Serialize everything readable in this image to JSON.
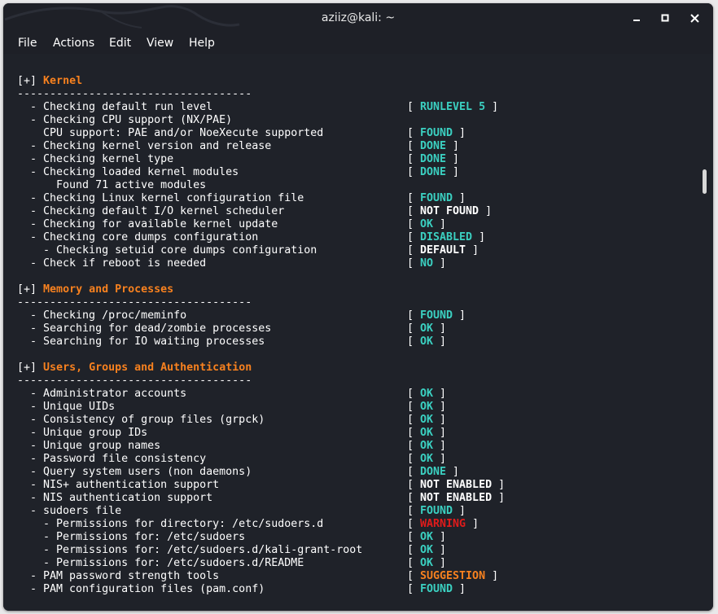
{
  "window": {
    "title": "aziiz@kali: ~"
  },
  "menu": [
    "File",
    "Actions",
    "Edit",
    "View",
    "Help"
  ],
  "colors": {
    "ok": "#3bd0c1",
    "white": "#ffffff",
    "warning": "#e01b1b",
    "orange": "#f7811f"
  },
  "terminal": {
    "lines": [
      {
        "type": "head",
        "bracket": "[+]",
        "title": "Kernel"
      },
      {
        "type": "text",
        "text": "------------------------------------"
      },
      {
        "type": "check",
        "text": "  - Checking default run level",
        "status": "RUNLEVEL 5",
        "color": "ok"
      },
      {
        "type": "text",
        "text": "  - Checking CPU support (NX/PAE)"
      },
      {
        "type": "check",
        "text": "    CPU support: PAE and/or NoeXecute supported",
        "status": "FOUND",
        "color": "ok"
      },
      {
        "type": "check",
        "text": "  - Checking kernel version and release",
        "status": "DONE",
        "color": "ok"
      },
      {
        "type": "check",
        "text": "  - Checking kernel type",
        "status": "DONE",
        "color": "ok"
      },
      {
        "type": "check",
        "text": "  - Checking loaded kernel modules",
        "status": "DONE",
        "color": "ok"
      },
      {
        "type": "text",
        "text": "      Found 71 active modules"
      },
      {
        "type": "check",
        "text": "  - Checking Linux kernel configuration file",
        "status": "FOUND",
        "color": "ok"
      },
      {
        "type": "check",
        "text": "  - Checking default I/O kernel scheduler",
        "status": "NOT FOUND",
        "color": "white"
      },
      {
        "type": "check",
        "text": "  - Checking for available kernel update",
        "status": "OK",
        "color": "ok"
      },
      {
        "type": "check",
        "text": "  - Checking core dumps configuration",
        "status": "DISABLED",
        "color": "ok"
      },
      {
        "type": "check",
        "text": "    - Checking setuid core dumps configuration",
        "status": "DEFAULT",
        "color": "white"
      },
      {
        "type": "check",
        "text": "  - Check if reboot is needed",
        "status": "NO",
        "color": "ok"
      },
      {
        "type": "blank"
      },
      {
        "type": "head",
        "bracket": "[+]",
        "title": "Memory and Processes"
      },
      {
        "type": "text",
        "text": "------------------------------------"
      },
      {
        "type": "check",
        "text": "  - Checking /proc/meminfo",
        "status": "FOUND",
        "color": "ok"
      },
      {
        "type": "check",
        "text": "  - Searching for dead/zombie processes",
        "status": "OK",
        "color": "ok"
      },
      {
        "type": "check",
        "text": "  - Searching for IO waiting processes",
        "status": "OK",
        "color": "ok"
      },
      {
        "type": "blank"
      },
      {
        "type": "head",
        "bracket": "[+]",
        "title": "Users, Groups and Authentication"
      },
      {
        "type": "text",
        "text": "------------------------------------"
      },
      {
        "type": "check",
        "text": "  - Administrator accounts",
        "status": "OK",
        "color": "ok"
      },
      {
        "type": "check",
        "text": "  - Unique UIDs",
        "status": "OK",
        "color": "ok"
      },
      {
        "type": "check",
        "text": "  - Consistency of group files (grpck)",
        "status": "OK",
        "color": "ok"
      },
      {
        "type": "check",
        "text": "  - Unique group IDs",
        "status": "OK",
        "color": "ok"
      },
      {
        "type": "check",
        "text": "  - Unique group names",
        "status": "OK",
        "color": "ok"
      },
      {
        "type": "check",
        "text": "  - Password file consistency",
        "status": "OK",
        "color": "ok"
      },
      {
        "type": "check",
        "text": "  - Query system users (non daemons)",
        "status": "DONE",
        "color": "ok"
      },
      {
        "type": "check",
        "text": "  - NIS+ authentication support",
        "status": "NOT ENABLED",
        "color": "white"
      },
      {
        "type": "check",
        "text": "  - NIS authentication support",
        "status": "NOT ENABLED",
        "color": "white"
      },
      {
        "type": "check",
        "text": "  - sudoers file",
        "status": "FOUND",
        "color": "ok"
      },
      {
        "type": "check",
        "text": "    - Permissions for directory: /etc/sudoers.d",
        "status": "WARNING",
        "color": "warning"
      },
      {
        "type": "check",
        "text": "    - Permissions for: /etc/sudoers",
        "status": "OK",
        "color": "ok"
      },
      {
        "type": "check",
        "text": "    - Permissions for: /etc/sudoers.d/kali-grant-root",
        "status": "OK",
        "color": "ok"
      },
      {
        "type": "check",
        "text": "    - Permissions for: /etc/sudoers.d/README",
        "status": "OK",
        "color": "ok"
      },
      {
        "type": "check",
        "text": "  - PAM password strength tools",
        "status": "SUGGESTION",
        "color": "orange"
      },
      {
        "type": "check",
        "text": "  - PAM configuration files (pam.conf)",
        "status": "FOUND",
        "color": "ok"
      }
    ]
  }
}
